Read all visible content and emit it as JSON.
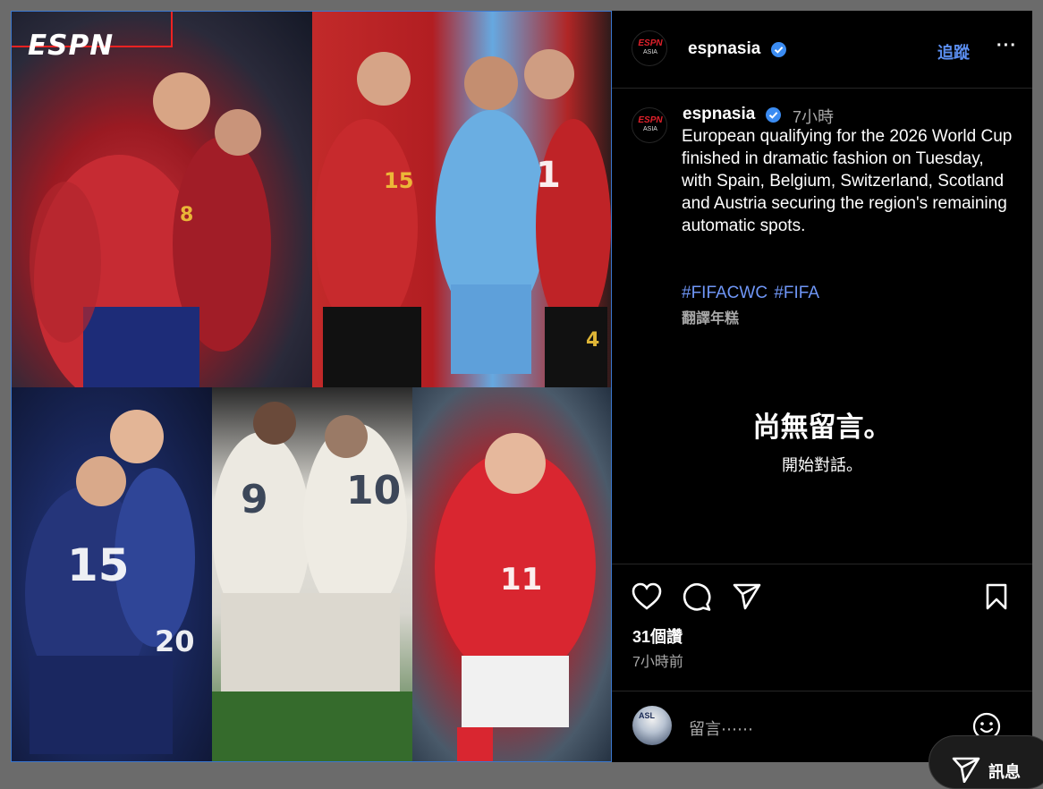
{
  "media": {
    "logo_text": "ESPN",
    "jerseys": {
      "p1": "8",
      "p2_a": "15",
      "p2_b": "1",
      "p2_c": "4",
      "p3_a": "15",
      "p3_b": "20",
      "p4_a": "9",
      "p4_b": "10",
      "p5": "11"
    }
  },
  "header": {
    "avatar_logo": "ESPN",
    "avatar_sub": "ASIA",
    "username": "espnasia",
    "follow_label": "追蹤",
    "more_label": "···"
  },
  "post": {
    "username": "espnasia",
    "time": "7小時",
    "caption": "European qualifying for the 2026 World Cup finished in dramatic fashion on Tuesday, with Spain, Belgium, Switzerland, Scotland and Austria securing the region's remaining automatic spots.",
    "hashtags": "#FIFACWC #FIFA",
    "translate_label": "翻譯年糕"
  },
  "comments": {
    "empty_title": "尚無留言。",
    "empty_subtitle": "開始對話。"
  },
  "actions": {
    "icons": [
      "heart-icon",
      "comment-icon",
      "share-icon",
      "bookmark-icon"
    ],
    "views": "31個讚",
    "posted": "7小時前"
  },
  "comment_box": {
    "avatar_text": "ASL",
    "placeholder": "留言⋯⋯"
  },
  "messages_button": {
    "label": "訊息"
  },
  "colors": {
    "accent": "#5b8ef0",
    "verified": "#3b8cf2",
    "espn_red": "#e1212b",
    "background": "#000000"
  }
}
